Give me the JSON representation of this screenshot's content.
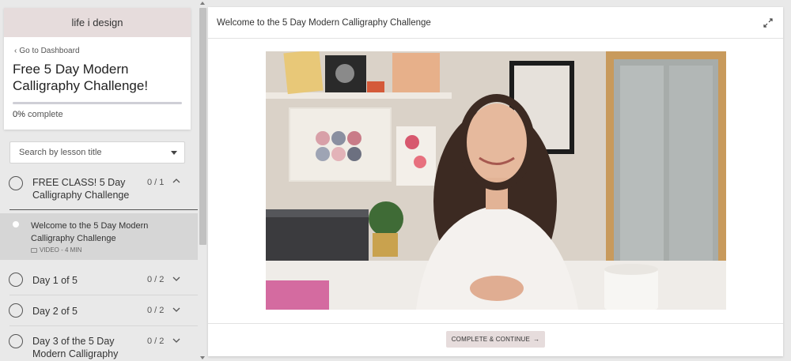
{
  "sidebar": {
    "brand": "life i design",
    "back_link": "Go to Dashboard",
    "course_title": "Free 5 Day Modern Calligraphy Challenge!",
    "progress": {
      "percent_label": "0%",
      "suffix": "complete",
      "fraction": 0
    },
    "search_placeholder": "Search by lesson title",
    "chapters": [
      {
        "title": "FREE CLASS! 5 Day Calligraphy Challenge",
        "count": "0 / 1",
        "expanded": true
      },
      {
        "title": "Day 1 of 5",
        "count": "0 / 2",
        "expanded": false
      },
      {
        "title": "Day 2 of 5",
        "count": "0 / 2",
        "expanded": false
      },
      {
        "title": "Day 3 of the 5 Day Modern Calligraphy",
        "count": "0 / 2",
        "expanded": false
      }
    ],
    "active_lesson": {
      "title": "Welcome to the 5 Day Modern Calligraphy Challenge",
      "meta": "VIDEO - 4 MIN"
    }
  },
  "main": {
    "header_title": "Welcome to the 5 Day Modern Calligraphy Challenge",
    "cta_label": "COMPLETE & CONTINUE",
    "cta_arrow": "→"
  },
  "colors": {
    "brand_bar": "#e6dcdc",
    "active_lesson_bg": "#d6d6d6",
    "page_bg": "#e9e9e9"
  },
  "icons": {
    "back": "chevron-left-icon",
    "search_dropdown": "caret-down-icon",
    "expanded": "chevron-up-icon",
    "collapsed": "chevron-down-icon",
    "video": "video-camera-icon",
    "fullscreen": "expand-icon",
    "cta": "arrow-right-icon"
  }
}
